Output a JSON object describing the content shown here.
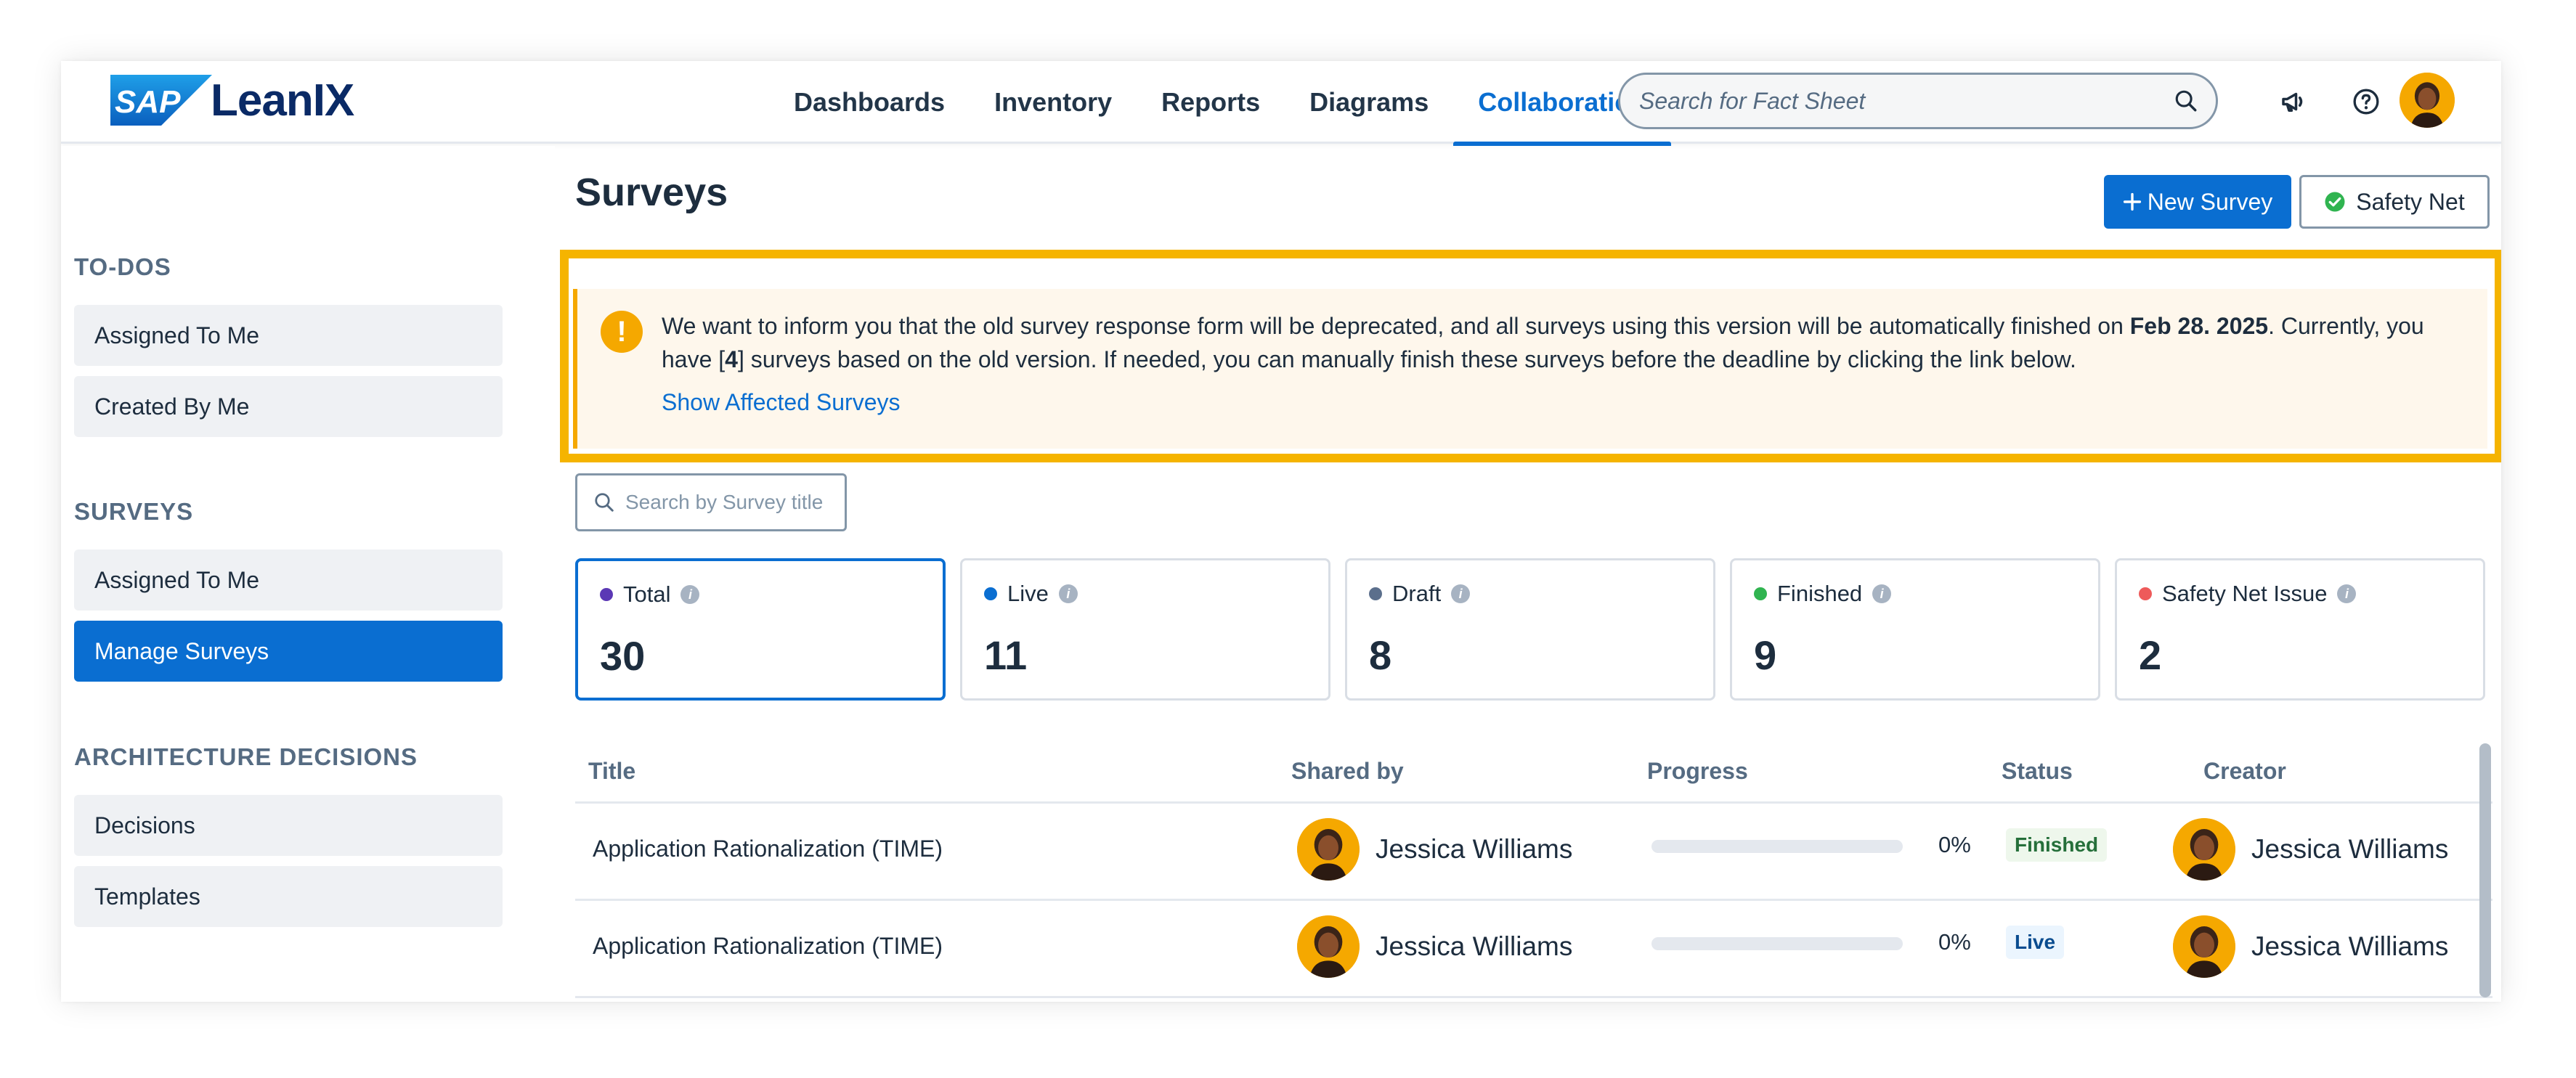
{
  "app": {
    "brand_mark": "SAP",
    "brand_name": "LeanIX"
  },
  "nav": {
    "items": [
      {
        "label": "Dashboards"
      },
      {
        "label": "Inventory"
      },
      {
        "label": "Reports"
      },
      {
        "label": "Diagrams"
      },
      {
        "label": "Collaboration",
        "active": true
      }
    ]
  },
  "search": {
    "placeholder": "Search for Fact Sheet"
  },
  "sidebar": {
    "sections": [
      {
        "heading": "TO-DOS",
        "items": [
          "Assigned To Me",
          "Created By Me"
        ]
      },
      {
        "heading": "SURVEYS",
        "items": [
          "Assigned To Me",
          "Manage Surveys"
        ],
        "active_item": "Manage Surveys"
      },
      {
        "heading": "ARCHITECTURE DECISIONS",
        "items": [
          "Decisions",
          "Templates"
        ]
      }
    ]
  },
  "page": {
    "title": "Surveys",
    "new_survey_label": "New Survey",
    "safety_net_label": "Safety Net"
  },
  "notice": {
    "text_part1": "We want to inform you that the old survey response form will be deprecated, and all surveys using this version will be automatically finished on ",
    "date": "Feb 28. 2025",
    "text_part2": ". Currently, you have [",
    "count": "4",
    "text_part3": "] surveys based on the old version. If needed, you can manually finish these surveys before the deadline by clicking the link below.",
    "link": "Show Affected Surveys"
  },
  "survey_search": {
    "placeholder": "Search by Survey title"
  },
  "stats": [
    {
      "label": "Total",
      "value": "30",
      "dot_color": "#5b38b5",
      "active": true
    },
    {
      "label": "Live",
      "value": "11",
      "dot_color": "#0a6ed1"
    },
    {
      "label": "Draft",
      "value": "8",
      "dot_color": "#5b6f8c"
    },
    {
      "label": "Finished",
      "value": "9",
      "dot_color": "#30b450"
    },
    {
      "label": "Safety Net Issue",
      "value": "2",
      "dot_color": "#ee5a5a"
    }
  ],
  "table": {
    "columns": [
      "Title",
      "Shared by",
      "Progress",
      "Status",
      "Creator"
    ],
    "rows": [
      {
        "title": "Application Rationalization (TIME)",
        "shared_by": "Jessica Williams",
        "progress": 0,
        "progress_label": "0%",
        "status": "Finished",
        "creator": "Jessica Williams"
      },
      {
        "title": "Application Rationalization (TIME)",
        "shared_by": "Jessica Williams",
        "progress": 0,
        "progress_label": "0%",
        "status": "Live",
        "creator": "Jessica Williams"
      }
    ]
  },
  "colors": {
    "accent": "#0a6ed1",
    "warning": "#f5a800",
    "highlight": "#f5b400"
  }
}
